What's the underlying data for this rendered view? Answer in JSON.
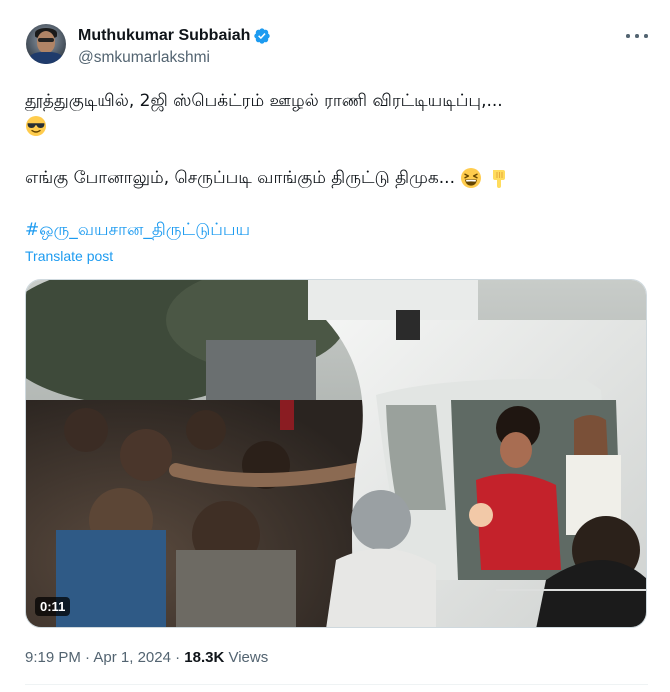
{
  "author": {
    "display_name": "Muthukumar Subbaiah",
    "handle": "@smkumarlakshmi",
    "verified": true,
    "avatar_icon": "profile-photo"
  },
  "more_icon": "more-horizontal-icon",
  "post": {
    "line1": "தூத்துகுடியில், 2ஜி ஸ்பெக்ட்ரம் ஊழல் ராணி விரட்டியடிப்பு,...",
    "line1_emoji": "smiling-face-with-sunglasses",
    "line2": "எங்கு போனாலும், செருப்படி வாங்கும் திருட்டு திமுக...",
    "line2_emojis": [
      "grinning-squinting-face",
      "backhand-index-pointing-down"
    ],
    "hashtag": "#ஒரு_வயசான_திருட்டுப்பய",
    "translate_label": "Translate post"
  },
  "media": {
    "type": "video",
    "duration": "0:11"
  },
  "meta": {
    "time": "9:19 PM",
    "separator": " · ",
    "date": "Apr 1, 2024",
    "dot": " · ",
    "views_count": "18.3K",
    "views_label": " Views"
  },
  "colors": {
    "link": "#1d9bf0",
    "secondary_text": "#536471",
    "primary_text": "#0f1419",
    "verified_badge": "#1d9bf0"
  }
}
